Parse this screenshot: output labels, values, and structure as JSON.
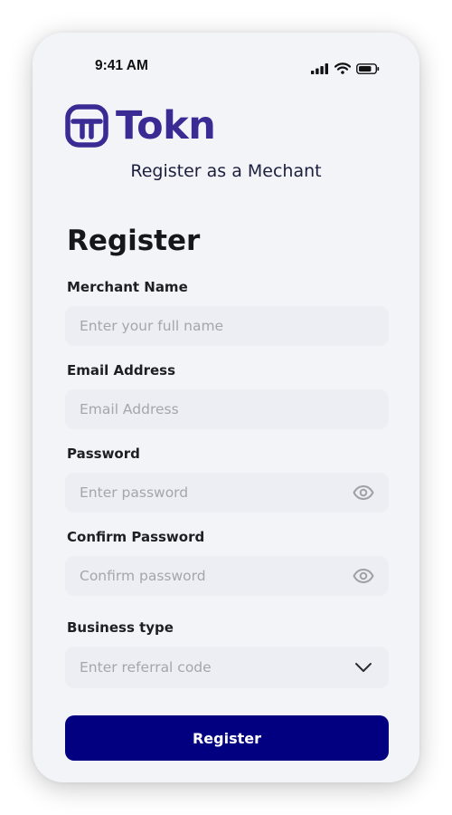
{
  "status_bar": {
    "time": "9:41 AM",
    "icons": [
      "signal-icon",
      "wifi-icon",
      "battery-icon"
    ]
  },
  "brand": {
    "name": "Tokn",
    "color": "#3a2a93"
  },
  "subtitle": "Register as a Mechant",
  "title": "Register",
  "fields": {
    "merchant_name": {
      "label": "Merchant Name",
      "placeholder": "Enter your full name",
      "value": ""
    },
    "email": {
      "label": "Email Address",
      "placeholder": "Email Address",
      "value": ""
    },
    "password": {
      "label": "Password",
      "placeholder": "Enter password",
      "value": "",
      "trailing_icon": "eye-icon"
    },
    "confirm_password": {
      "label": "Confirm Password",
      "placeholder": "Confirm password",
      "value": "",
      "trailing_icon": "eye-icon"
    },
    "business_type": {
      "label": "Business type",
      "placeholder": "Enter referral code",
      "value": "",
      "trailing_icon": "chevron-down-icon"
    }
  },
  "register_button": {
    "label": "Register",
    "color": "#020080"
  }
}
